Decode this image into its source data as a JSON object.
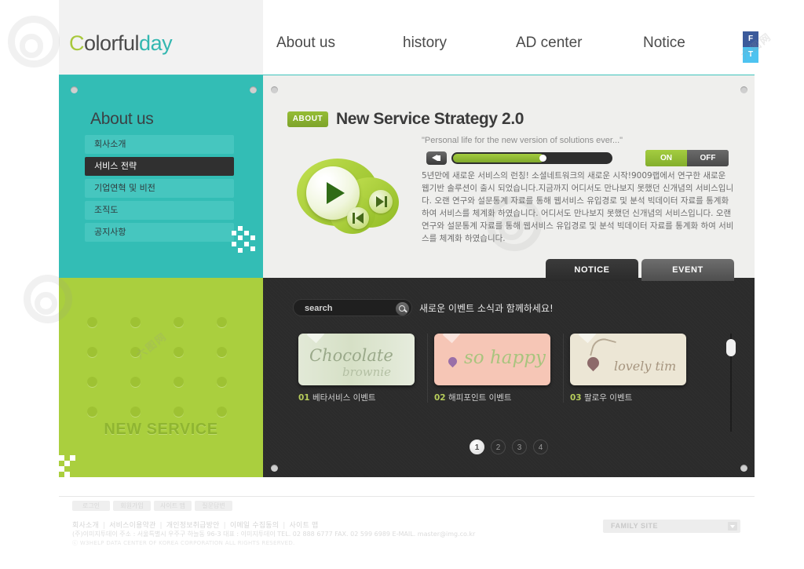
{
  "header": {
    "logo": {
      "part1": "C",
      "part2": "olorful",
      "part3": "day"
    },
    "nav": [
      {
        "label": "About us"
      },
      {
        "label": "history"
      },
      {
        "label": "AD center"
      },
      {
        "label": "Notice"
      }
    ],
    "social": [
      {
        "label": "F",
        "name": "facebook"
      },
      {
        "label": "T",
        "name": "twitter"
      }
    ]
  },
  "sidebar": {
    "title": "About us",
    "items": [
      {
        "label": "회사소개",
        "active": false
      },
      {
        "label": "서비스 전략",
        "active": true
      },
      {
        "label": "기업연혁 및 비전",
        "active": false
      },
      {
        "label": "조직도",
        "active": false
      },
      {
        "label": "공지사항",
        "active": false
      }
    ]
  },
  "promo": {
    "title": "NEW SERVICE"
  },
  "main": {
    "badge": "ABOUT",
    "title": "New Service Strategy 2.0",
    "quote": "\"Personal life for the new version of solutions ever...\"",
    "toggle": {
      "on": "ON",
      "off": "OFF",
      "state": "ON"
    },
    "progress_percent": 56,
    "body": "5년만에 새로운 서비스의 런칭! 소셜네트워크의 새로운 시작!9009랩에서 연구한 새로운 웹기반 솔루션이 출시 되었습니다.지금까지 어디서도 만나보지 못했던 신개념의 서비스입니다. 오랜 연구와 설문통계 자료를 통해 웹서비스 유입경로 및 분석 빅데이터 자료를 통계화 하여 서비스를 체계화 하였습니다. 어디서도 만나보지 못했던 신개념의 서비스입니다. 오랜 연구와 설문통계 자료를 통해 웹서비스 유입경로 및 분석 빅데이터 자료를 통계화 하여 서비스를 체계화 하였습니다."
  },
  "tabs": [
    {
      "label": "NOTICE",
      "active": true
    },
    {
      "label": "EVENT",
      "active": false
    }
  ],
  "events": {
    "search": {
      "value": "search",
      "placeholder": "search"
    },
    "tagline": "새로운 이벤트 소식과 함께하세요!",
    "cards": [
      {
        "num": "01",
        "label": "베타서비스 이벤트",
        "script_main": "Chocolate",
        "script_sub": "brownie"
      },
      {
        "num": "02",
        "label": "해피포인트 이벤트",
        "script_main": "so happy",
        "script_sub": ""
      },
      {
        "num": "03",
        "label": "팔로우 이벤트",
        "script_main": "lovely tim",
        "script_sub": ""
      }
    ],
    "pagination": [
      {
        "label": "1",
        "active": true
      },
      {
        "label": "2",
        "active": false
      },
      {
        "label": "3",
        "active": false
      },
      {
        "label": "4",
        "active": false
      }
    ]
  },
  "footer": {
    "buttons": [
      {
        "label": "로그인"
      },
      {
        "label": "회원가입"
      },
      {
        "label": "사이트 맵"
      },
      {
        "label": "질문답변"
      }
    ],
    "links": [
      {
        "label": "회사소개"
      },
      {
        "label": "서비스이용약관"
      },
      {
        "label": "개인정보취급방안"
      },
      {
        "label": "이메일 수집동의"
      },
      {
        "label": "사이트 맵"
      }
    ],
    "address": "(주)이미지투데이   주소 : 서울특별시 우주구 하늘동 96-3   대표 : 이미지투데이   TEL. 02 888 6777  FAX. 02 599 6989 E-MAIL. master@img.co.kr",
    "copyright": "ⓒ W3HELP DATA CENTER OF KOREA CORPORATION ALL RIGHTS RESERVED.",
    "family_site": "FAMILY SITE"
  },
  "colors": {
    "teal": "#33bdb5",
    "green": "#aacf3e",
    "dark": "#2b2b2b",
    "accent_green": "#95bd36",
    "facebook": "#3b5a9b",
    "twitter": "#4ec3f0"
  }
}
